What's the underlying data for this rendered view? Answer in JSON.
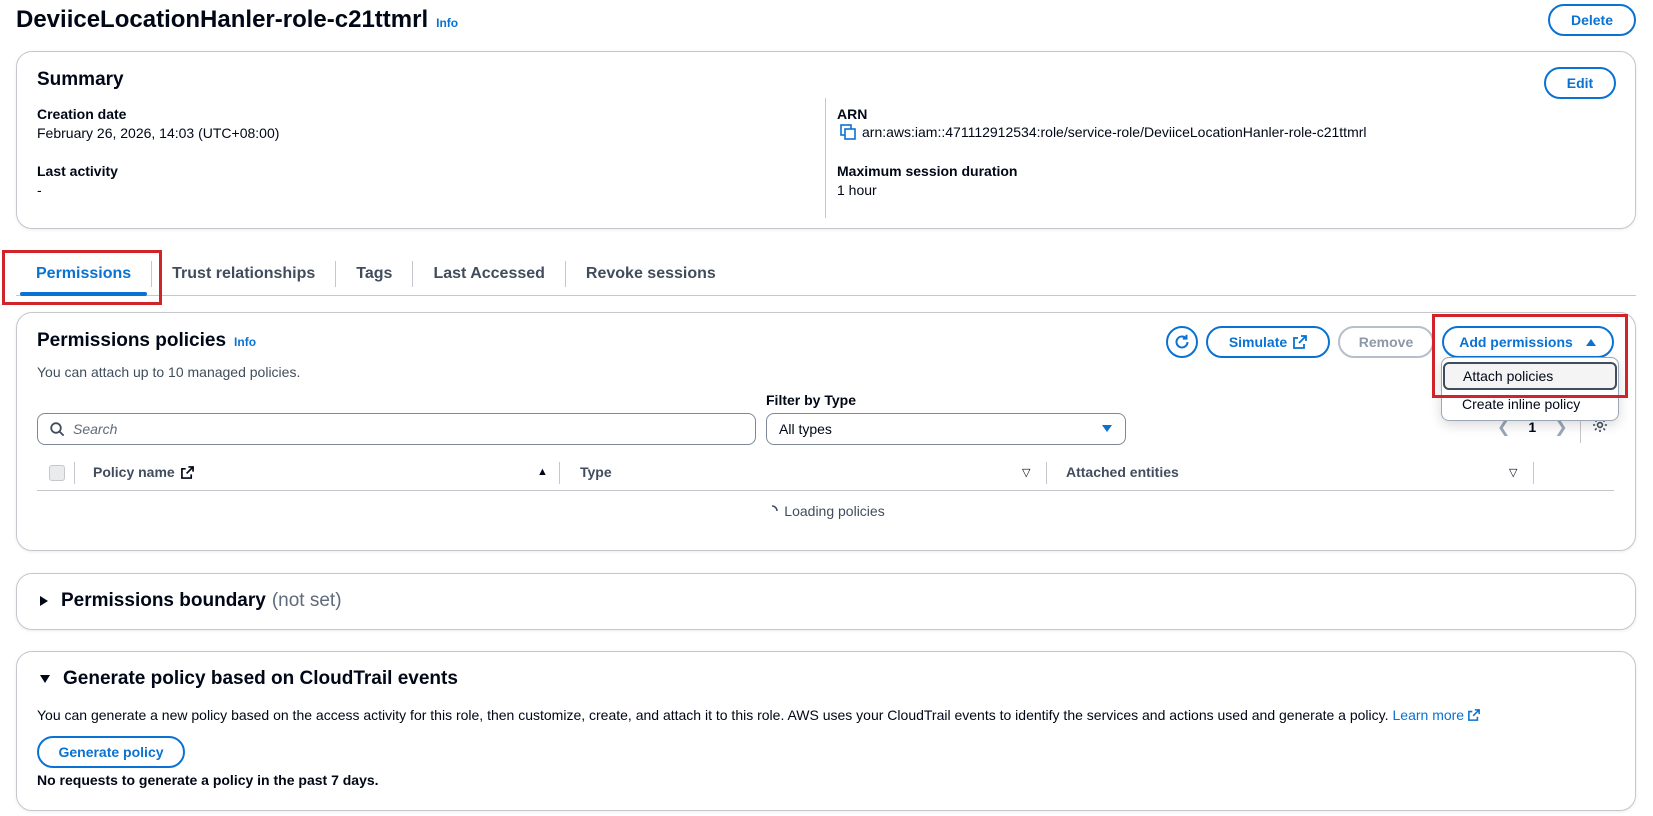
{
  "header": {
    "title": "DeviiceLocationHanler-role-c21ttmrl",
    "info": "Info",
    "delete": "Delete"
  },
  "summary": {
    "title": "Summary",
    "edit": "Edit",
    "creation_date_label": "Creation date",
    "creation_date": "February 26, 2026, 14:03 (UTC+08:00)",
    "last_activity_label": "Last activity",
    "last_activity": "-",
    "arn_label": "ARN",
    "arn": "arn:aws:iam::471112912534:role/service-role/DeviiceLocationHanler-role-c21ttmrl",
    "max_session_label": "Maximum session duration",
    "max_session": "1 hour"
  },
  "tabs": [
    {
      "label": "Permissions",
      "active": true
    },
    {
      "label": "Trust relationships"
    },
    {
      "label": "Tags"
    },
    {
      "label": "Last Accessed"
    },
    {
      "label": "Revoke sessions"
    }
  ],
  "policies": {
    "title": "Permissions policies",
    "info": "Info",
    "description": "You can attach up to 10 managed policies.",
    "simulate": "Simulate",
    "remove": "Remove",
    "add_permissions": "Add permissions",
    "filter_label": "Filter by Type",
    "search_placeholder": "Search",
    "type_selected": "All types",
    "page": "1",
    "columns": {
      "policy_name": "Policy name",
      "type": "Type",
      "attached_entities": "Attached entities"
    },
    "loading": "Loading policies",
    "dropdown": {
      "attach": "Attach policies",
      "inline": "Create inline policy"
    }
  },
  "boundary": {
    "title": "Permissions boundary",
    "status": "(not set)"
  },
  "generate": {
    "title": "Generate policy based on CloudTrail events",
    "description": "You can generate a new policy based on the access activity for this role, then customize, create, and attach it to this role. AWS uses your CloudTrail events to identify the services and actions used and generate a policy.",
    "learn_more": "Learn more",
    "button": "Generate policy",
    "note": "No requests to generate a policy in the past 7 days."
  },
  "colors": {
    "accent": "#0972d3",
    "highlight": "#d1232a"
  }
}
